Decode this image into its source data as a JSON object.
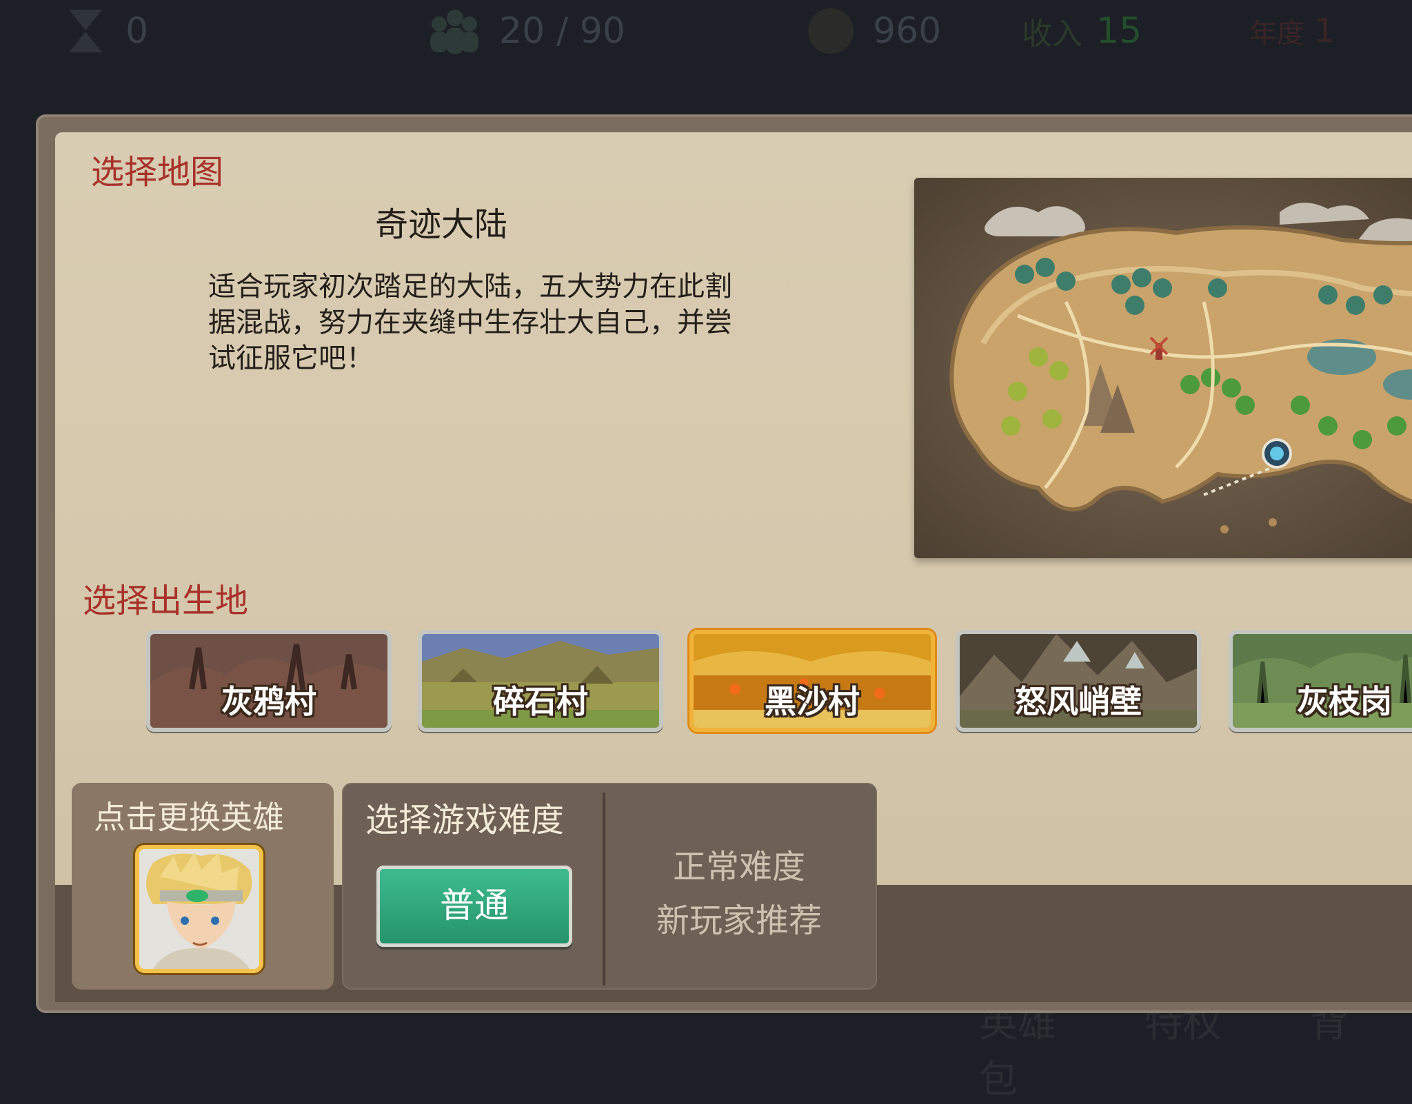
{
  "top_bar": {
    "turn_count": "0",
    "population": "20 / 90",
    "gold": "960",
    "income_label": "收入",
    "income_value": "15",
    "year_label": "年度",
    "year_value": "1"
  },
  "map_section": {
    "title": "选择地图",
    "map_name": "奇迹大陆",
    "description": "适合玩家初次踏足的大陆，五大势力在此割据混战，努力在夹缝中生存壮大自己，并尝试征服它吧！"
  },
  "birthplace_section": {
    "title": "选择出生地",
    "options": [
      {
        "label": "灰鸦村",
        "selected": false
      },
      {
        "label": "碎石村",
        "selected": false
      },
      {
        "label": "黑沙村",
        "selected": true
      },
      {
        "label": "怒风峭壁",
        "selected": false
      },
      {
        "label": "灰枝岗",
        "selected": false
      }
    ]
  },
  "hero_section": {
    "title": "点击更换英雄"
  },
  "difficulty_section": {
    "title": "选择游戏难度",
    "button_label": "普通",
    "info_line1": "正常难度",
    "info_line2": "新玩家推荐"
  },
  "bottom_dim": {
    "items": [
      "英雄",
      "特权",
      "背包"
    ]
  },
  "colors": {
    "section_title": "#a8322a",
    "selected_card_border": "#f1b23a",
    "difficulty_button": "#26946b",
    "panel_bg": "#7a6d60"
  }
}
